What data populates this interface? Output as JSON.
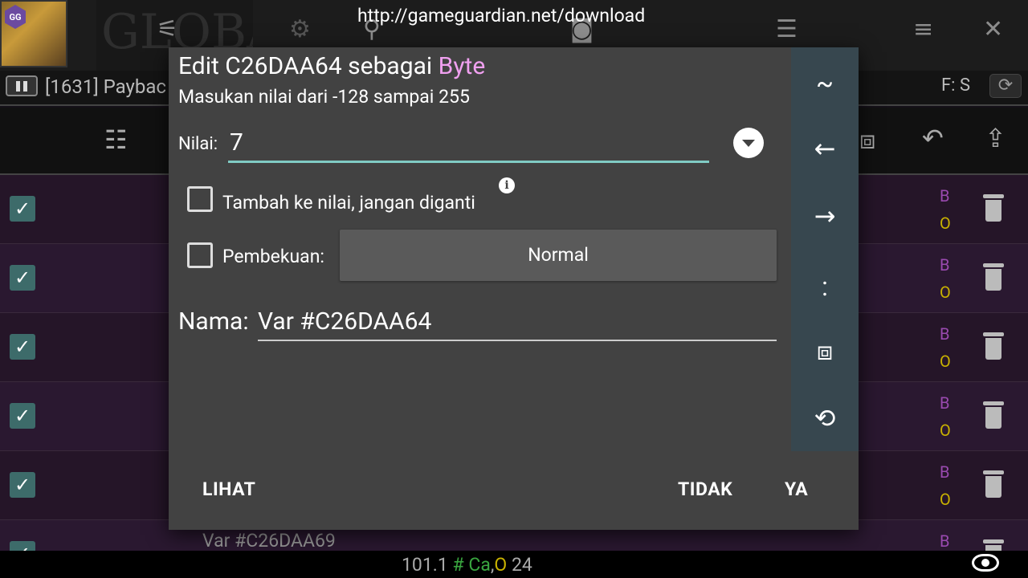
{
  "overlay": {
    "url": "http://gameguardian.net/download"
  },
  "background": {
    "banner_text": "GLOBAL",
    "gg_badge": "GG",
    "process_text": "[1631] Paybac",
    "freeze_status": "F: S",
    "behind_row_text": "Var #C26DAA69",
    "bottom_stats": {
      "value": "101.1",
      "hash": "#",
      "ca": "Ca",
      "comma": ",",
      "o": "O",
      "count": "24"
    },
    "row_type": "B",
    "row_flag": "O"
  },
  "dialog": {
    "title_prefix": "Edit C26DAA64 sebagai ",
    "title_type": "Byte",
    "subtitle": "Masukan nilai dari -128 sampai 255",
    "value_label": "Nilai:",
    "value": "7",
    "add_checkbox_label": "Tambah ke nilai, jangan diganti",
    "info_glyph": "i",
    "freeze_label": "Pembekuan:",
    "freeze_mode": "Normal",
    "name_label": "Nama:",
    "name_value": "Var #C26DAA64",
    "side_keys": [
      "~",
      "←",
      "→",
      ":",
      "⧈",
      "⟲"
    ],
    "buttons": {
      "view": "LIHAT",
      "no": "TIDAK",
      "yes": "YA"
    }
  }
}
